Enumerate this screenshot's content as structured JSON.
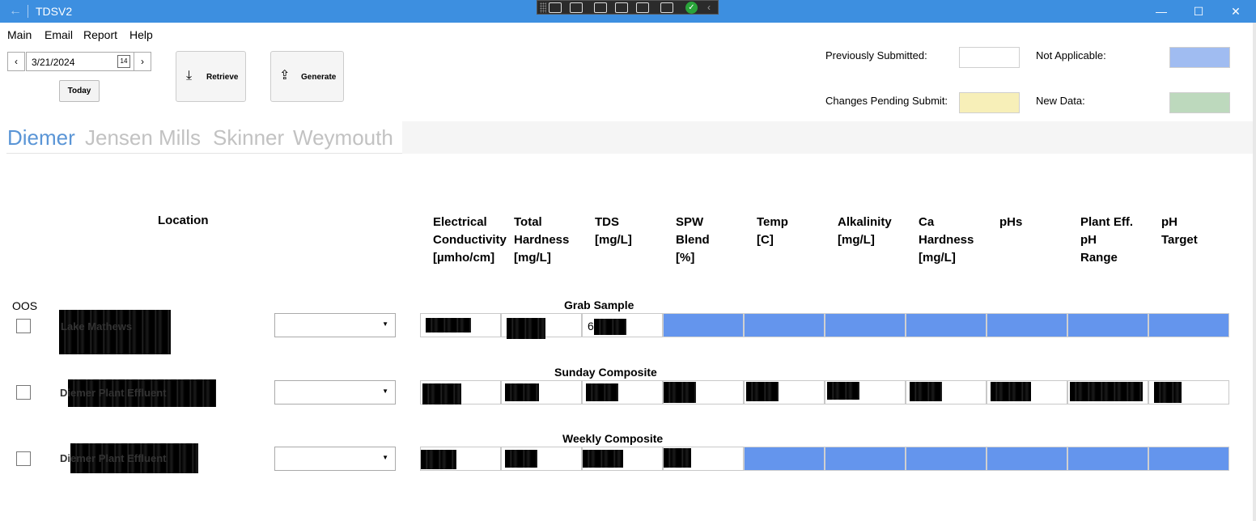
{
  "window": {
    "title": "TDSV2",
    "back_icon": "arrow-left-icon",
    "min_glyph": "—",
    "max_glyph": "☐",
    "close_glyph": "✕"
  },
  "menu": [
    "Main",
    "Email",
    "Report",
    "Help"
  ],
  "date": {
    "value": "3/21/2024",
    "prev_glyph": "‹",
    "next_glyph": "›",
    "calendar_day": "14",
    "today_label": "Today"
  },
  "actions": {
    "retrieve_label": "Retrieve",
    "generate_label": "Generate",
    "retrieve_glyph": "⤓",
    "generate_glyph": "⇪"
  },
  "legend": {
    "previously_submitted": "Previously Submitted:",
    "changes_pending": "Changes Pending Submit:",
    "not_applicable": "Not Applicable:",
    "new_data": "New Data:",
    "colors": {
      "previously_submitted": "#ffffff",
      "changes_pending": "#f7efb8",
      "not_applicable": "#a0bcf1",
      "new_data": "#bdd9bd"
    }
  },
  "tabs": [
    "Diemer",
    "Jensen",
    "Mills",
    "Skinner",
    "Weymouth"
  ],
  "table": {
    "location_header": "Location",
    "oos_label": "OOS",
    "columns": [
      [
        "Electrical",
        "Conductivity",
        "[µmho/cm]"
      ],
      [
        "Total",
        "Hardness",
        "[mg/L]"
      ],
      [
        "TDS",
        "[mg/L]"
      ],
      [
        "SPW",
        "Blend",
        "[%]"
      ],
      [
        "Temp",
        "[C]"
      ],
      [
        "Alkalinity",
        "[mg/L]"
      ],
      [
        "Ca",
        "Hardness",
        "[mg/L]"
      ],
      [
        "pHs"
      ],
      [
        "Plant Eff.",
        "pH",
        "Range"
      ],
      [
        "pH",
        "Target"
      ]
    ],
    "rows": [
      {
        "section": "Grab Sample",
        "location": "Lake Mathews",
        "visible_values": [
          "",
          "",
          "6",
          "",
          "",
          "",
          "",
          "",
          "",
          ""
        ]
      },
      {
        "section": "Sunday Composite",
        "location": "Diemer Plant Effluent",
        "visible_values": [
          "",
          "",
          "",
          "",
          "",
          "",
          "",
          "",
          "",
          ""
        ]
      },
      {
        "section": "Weekly Composite",
        "location": "Diemer Plant Effluent",
        "visible_values": [
          "",
          "",
          "",
          "",
          "",
          "",
          "",
          "",
          "",
          ""
        ]
      }
    ]
  }
}
